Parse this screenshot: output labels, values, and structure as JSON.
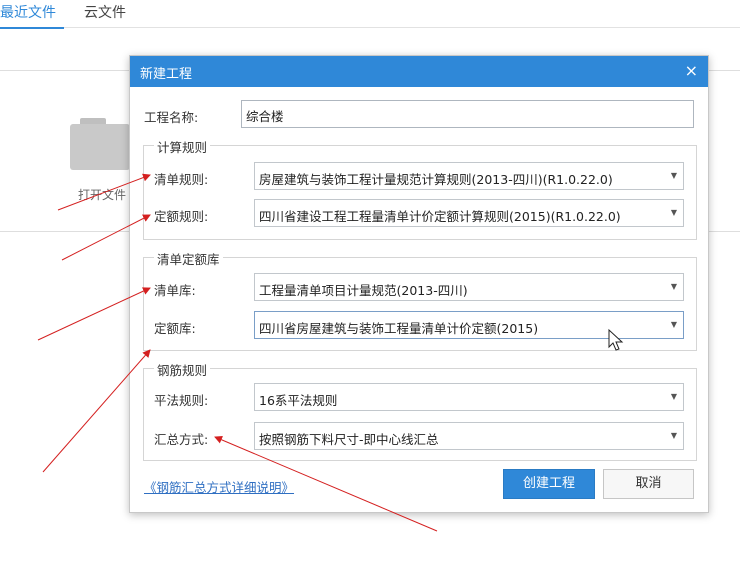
{
  "tabs": {
    "recent": "最近文件",
    "cloud": "云文件"
  },
  "background": {
    "open_label": "打开文件"
  },
  "dialog": {
    "title": "新建工程",
    "close_glyph": "×",
    "project_name_label": "工程名称:",
    "project_name_value": "综合楼",
    "calc_rules": {
      "group_title": "计算规则",
      "qingdan_label": "清单规则:",
      "qingdan_value": "房屋建筑与装饰工程计量规范计算规则(2013-四川)(R1.0.22.0)",
      "dinge_label": "定额规则:",
      "dinge_value": "四川省建设工程工程量清单计价定额计算规则(2015)(R1.0.22.0)"
    },
    "libraries": {
      "group_title": "清单定额库",
      "qingdan_lib_label": "清单库:",
      "qingdan_lib_value": "工程量清单项目计量规范(2013-四川)",
      "dinge_lib_label": "定额库:",
      "dinge_lib_value": "四川省房屋建筑与装饰工程量清单计价定额(2015)"
    },
    "rebar_rules": {
      "group_title": "钢筋规则",
      "pingfa_label": "平法规则:",
      "pingfa_value": "16系平法规则",
      "summary_label": "汇总方式:",
      "summary_value": "按照钢筋下料尺寸-即中心线汇总"
    },
    "detail_link": "《钢筋汇总方式详细说明》",
    "create_button": "创建工程",
    "cancel_button": "取消"
  },
  "colors": {
    "accent": "#2f88d8",
    "annotation": "#d42020"
  },
  "icons": {
    "dropdown": "chevron-down-icon",
    "folder": "folder-icon",
    "cursor": "mouse-pointer-icon"
  }
}
